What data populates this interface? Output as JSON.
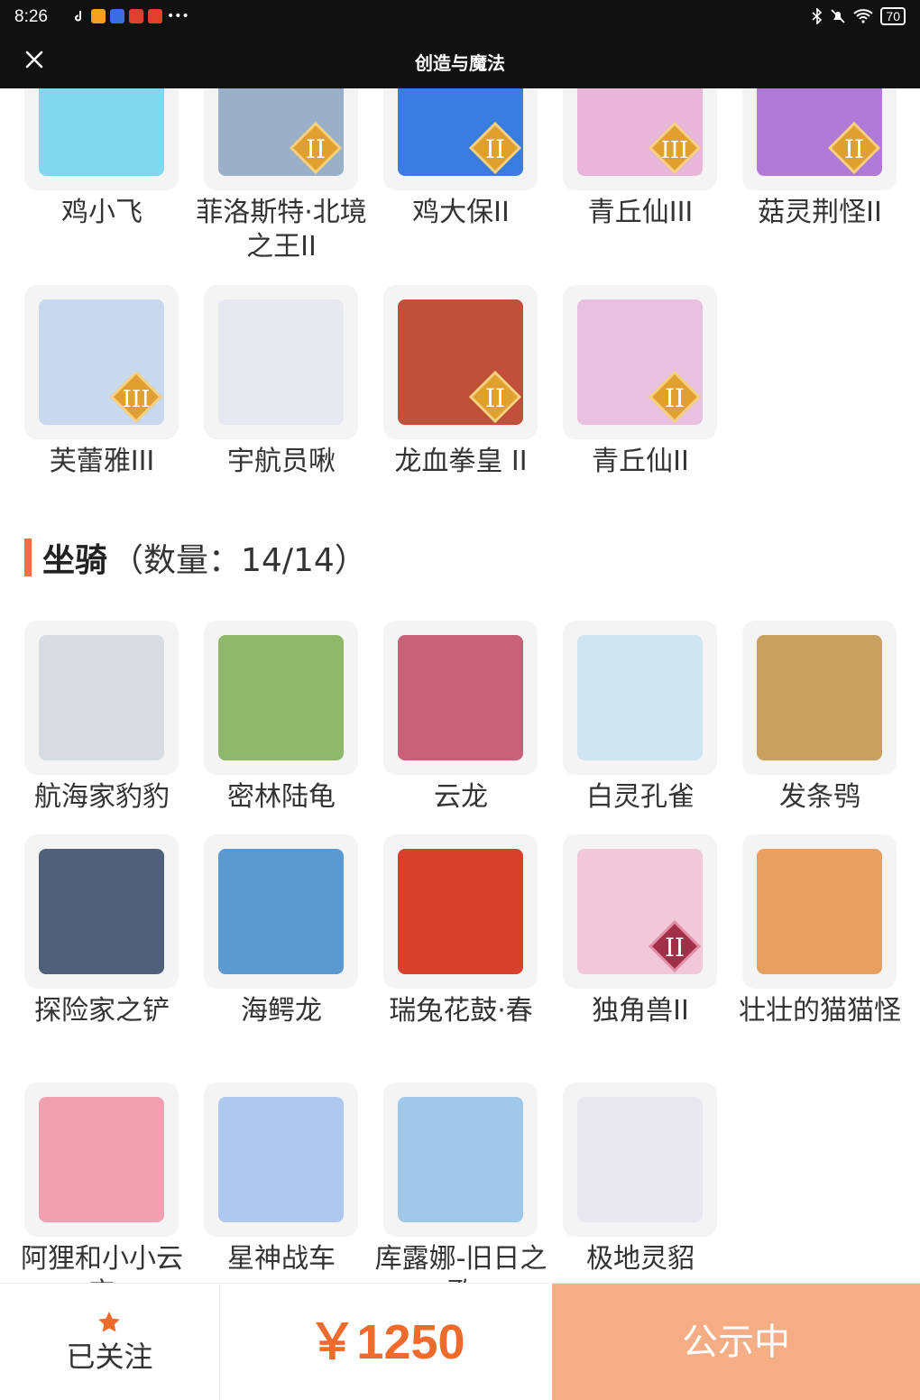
{
  "status_bar": {
    "time": "8:26",
    "battery": "70"
  },
  "header": {
    "title": "创造与魔法"
  },
  "pets_top_row": [
    {
      "name": "鸡小飞",
      "color": "#7fd8ee"
    },
    {
      "name": "菲洛斯特·北境之王II",
      "color": "#9ab0c8"
    },
    {
      "name": "鸡大保II",
      "color": "#3a7de0"
    },
    {
      "name": "青丘仙III",
      "color": "#e8b6d8"
    },
    {
      "name": "菇灵荆怪II",
      "color": "#b07ad8"
    }
  ],
  "pets_second_row": [
    {
      "name": "芙蕾雅III",
      "color": "#c8d8ee"
    },
    {
      "name": "宇航员啾",
      "color": "#e8e8f0"
    },
    {
      "name": "龙血拳皇 II",
      "color": "#c0503a"
    },
    {
      "name": "青丘仙II",
      "color": "#e8c0e0"
    }
  ],
  "mounts_section": {
    "title": "坐骑",
    "count_text": "（数量：14/14）"
  },
  "mounts": [
    {
      "name": "航海家豹豹",
      "color": "#d8dce0"
    },
    {
      "name": "密林陆龟",
      "color": "#8fb86a"
    },
    {
      "name": "云龙",
      "color": "#c8607a"
    },
    {
      "name": "白灵孔雀",
      "color": "#cfe6f2"
    },
    {
      "name": "发条鸮",
      "color": "#c8a060"
    },
    {
      "name": "探险家之铲",
      "color": "#50607a"
    },
    {
      "name": "海鳄龙",
      "color": "#5a9ad0"
    },
    {
      "name": "瑞兔花鼓·春",
      "color": "#d8402e"
    },
    {
      "name": "独角兽II",
      "color": "#f0c8d8"
    },
    {
      "name": "壮壮的猫猫怪",
      "color": "#e8a060"
    },
    {
      "name": "阿狸和小小云宝",
      "color": "#f0a0b0"
    },
    {
      "name": "星神战车",
      "color": "#b0c8f0"
    },
    {
      "name": "库露娜-旧日之歌",
      "color": "#a0c8e8"
    },
    {
      "name": "极地灵貂",
      "color": "#e8e8ee"
    }
  ],
  "bottom_bar": {
    "follow_label": "已关注",
    "price": "￥1250",
    "status_label": "公示中"
  }
}
